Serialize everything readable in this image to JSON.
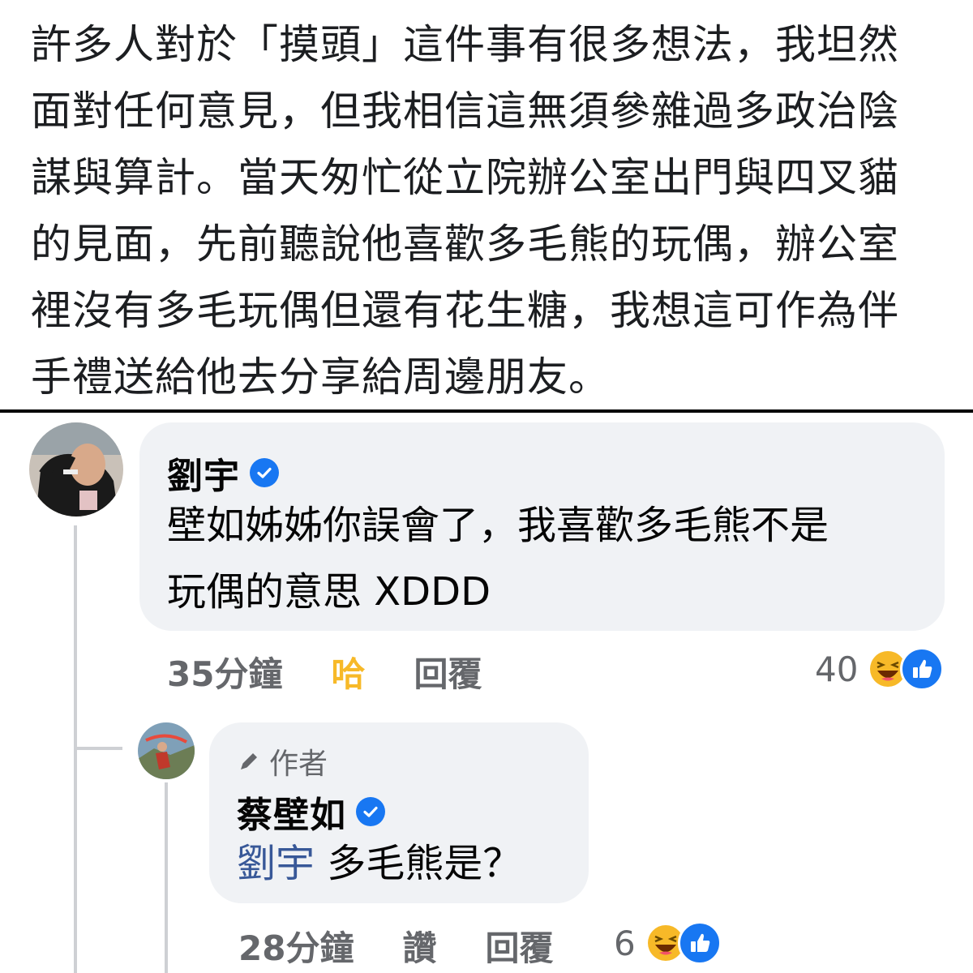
{
  "post": {
    "text": "許多人對於「摸頭」這件事有很多想法，我坦然\n面對任何意見，但我相信這無須參雜過多政治陰\n謀與算計。當天匆忙從立院辦公室出門與四叉貓\n的見面，先前聽說他喜歡多毛熊的玩偶，辦公室\n裡沒有多毛玩偶但還有花生糖，我想這可作為伴\n手禮送給他去分享給周邊朋友。"
  },
  "comments": [
    {
      "author": "劉宇",
      "verified": true,
      "text": "壁如姊姊你誤會了，我喜歡多毛熊不是\n玩偶的意思 XDDD",
      "time": "35分鐘",
      "reaction_action": "哈",
      "reply_label": "回覆",
      "reaction_count": "40",
      "reaction_icons": [
        "haha-icon",
        "like-icon"
      ]
    },
    {
      "author_badge": "作者",
      "author": "蔡壁如",
      "verified": true,
      "mention": "劉宇",
      "text": " 多毛熊是？",
      "time": "28分鐘",
      "reaction_action": "讚",
      "reply_label": "回覆",
      "reaction_count": "6",
      "reaction_icons": [
        "haha-icon",
        "like-icon"
      ]
    }
  ],
  "colors": {
    "bubble": "#f0f2f5",
    "verified": "#1877f2",
    "haha_reacted": "#f7b928",
    "mention": "#385898",
    "meta": "#65676b"
  }
}
